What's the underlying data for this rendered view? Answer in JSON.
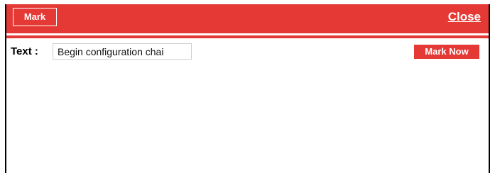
{
  "header": {
    "tab_label": "Mark",
    "close_label": "Close"
  },
  "form": {
    "text_label": "Text :",
    "text_value": "Begin configuration chai",
    "submit_label": "Mark Now"
  },
  "colors": {
    "accent": "#e53935",
    "text": "#000000",
    "background": "#ffffff"
  }
}
